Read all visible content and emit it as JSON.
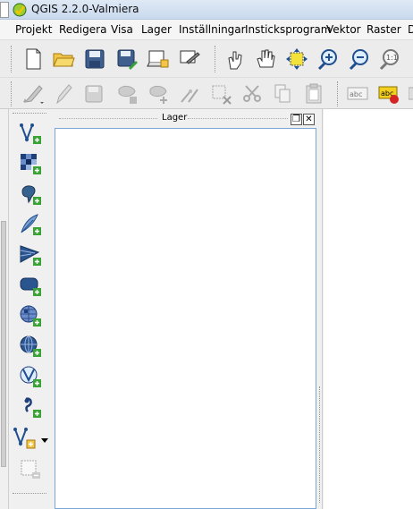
{
  "window": {
    "title": "QGIS 2.2.0-Valmiera"
  },
  "menu": {
    "items": [
      {
        "label": "Projekt"
      },
      {
        "label": "Redigera"
      },
      {
        "label": "Visa"
      },
      {
        "label": "Lager"
      },
      {
        "label": "Inställningar"
      },
      {
        "label": "Insticksprogram"
      },
      {
        "label": "Vektor"
      },
      {
        "label": "Raster"
      },
      {
        "label": "D"
      }
    ]
  },
  "layers_panel": {
    "title": "Lager",
    "restore_glyph": "❐",
    "close_glyph": "✕"
  },
  "colors": {
    "title_gradient_top": "#dfe9f5",
    "panel_border": "#7aa7d6",
    "accent_green": "#3aa335",
    "accent_blue": "#1f4f8f"
  },
  "toolbar_icons": {
    "file": [
      "new-project-icon",
      "open-project-icon",
      "save-project-icon",
      "save-as-icon",
      "new-print-composer-icon",
      "composer-manager-icon"
    ],
    "navigation": [
      "touch-zoom-icon",
      "pan-icon",
      "pan-to-selection-icon",
      "zoom-in-icon",
      "zoom-out-icon",
      "zoom-actual-size-icon"
    ],
    "digitizing": [
      "current-edits-icon",
      "toggle-editing-icon",
      "save-layer-edits-icon",
      "add-feature-icon",
      "move-feature-icon",
      "node-tool-icon",
      "delete-selected-icon",
      "cut-features-icon",
      "copy-features-icon",
      "paste-features-icon"
    ],
    "labeling": [
      "label-icon",
      "layer-labeling-icon"
    ]
  },
  "layer_toolbar_icons": [
    "add-vector-layer-icon",
    "add-raster-layer-icon",
    "add-postgis-layer-icon",
    "add-spatialite-layer-icon",
    "add-mssql-layer-icon",
    "add-oracle-layer-icon",
    "add-wms-layer-icon",
    "add-wcs-layer-icon",
    "add-wfs-layer-icon",
    "add-delimited-text-layer-icon",
    "new-vector-layer-icon",
    "remove-layer-icon"
  ]
}
